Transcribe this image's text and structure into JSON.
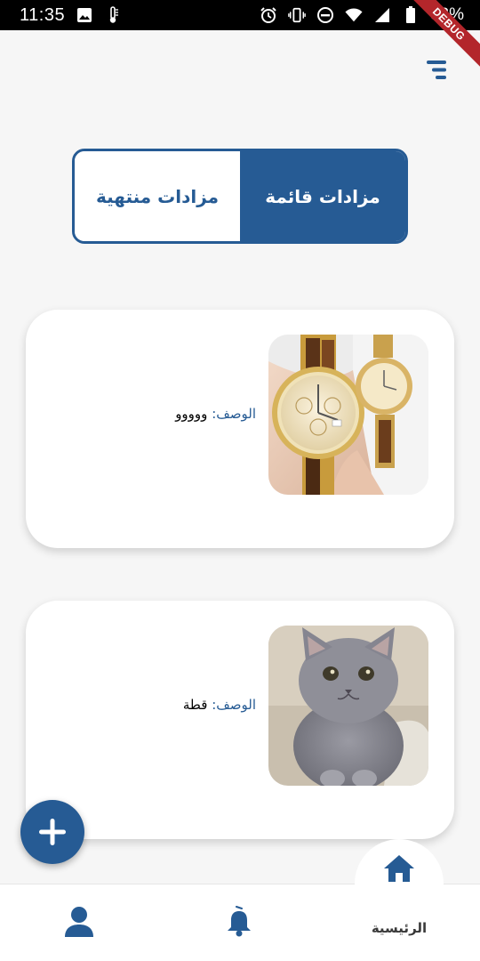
{
  "status_bar": {
    "time": "11:35",
    "battery": "83%"
  },
  "debug_banner": "DEBUG",
  "tabs": {
    "active": "مزادات قائمة",
    "ended": "مزادات منتهية"
  },
  "auctions": [
    {
      "desc_label": "الوصف:",
      "desc_value": "ووووو",
      "image": "watch-photo"
    },
    {
      "desc_label": "الوصف:",
      "desc_value": "قطة",
      "image": "cat-photo"
    }
  ],
  "nav": {
    "home_label": "الرئيسية"
  },
  "colors": {
    "primary": "#265b94",
    "background": "#f6f6f6"
  }
}
